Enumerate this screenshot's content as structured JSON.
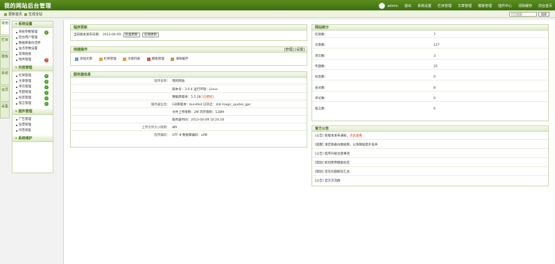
{
  "header": {
    "title": "我的网站后台管理",
    "user": "admin",
    "nav": [
      "退出",
      "系统设置",
      "栏目管理",
      "文章管理",
      "模板管理",
      "插件中心",
      "清除缓存",
      "前台首页"
    ]
  },
  "subbar": {
    "links": [
      "更新首页",
      "生成全站"
    ],
    "search_placeholder": "栏目搜索",
    "search_button": "搜索"
  },
  "vtabs": [
    "常用",
    "栏目",
    "模板",
    "系统",
    "会员",
    "采集"
  ],
  "sidebar": {
    "sections": [
      {
        "label": "系统设置",
        "items": [
          {
            "label": "系统参数管理",
            "status": "ok"
          },
          {
            "label": "后台用户管理",
            "status": ""
          },
          {
            "label": "数据库备份还原",
            "status": ""
          },
          {
            "label": "站点参数设置",
            "status": ""
          },
          {
            "label": "友情链接",
            "status": ""
          },
          {
            "label": "附件管理",
            "status": "bad"
          }
        ]
      },
      {
        "label": "内容管理",
        "items": [
          {
            "label": "栏目管理",
            "status": "ok"
          },
          {
            "label": "文章管理",
            "status": "ok"
          },
          {
            "label": "单页管理",
            "status": "ok"
          },
          {
            "label": "专题管理",
            "status": "ok"
          },
          {
            "label": "标签管理",
            "status": "ok"
          },
          {
            "label": "留言管理",
            "status": "ok"
          }
        ]
      },
      {
        "label": "插件管理",
        "items": [
          {
            "label": "广告管理",
            "status": ""
          },
          {
            "label": "投票管理",
            "status": ""
          },
          {
            "label": "问卷调查",
            "status": ""
          }
        ]
      },
      {
        "label": "系统维护",
        "items": []
      }
    ]
  },
  "panels": {
    "update": {
      "title": "程序更新",
      "text": "当前版本发布日期：",
      "date": "2013-04-09",
      "btn_check": "检查更新",
      "btn_update": "在线更新"
    },
    "quick": {
      "title": "快捷操作",
      "links": [
        "[管理]",
        "[设置]"
      ],
      "items": [
        "添加文章",
        "栏目管理",
        "文章列表",
        "模板管理",
        "清除缓存"
      ]
    },
    "sysinfo": {
      "title": "服务器信息",
      "rows": [
        {
          "label": "程序名称：",
          "value": "我的网站"
        },
        {
          "label": "",
          "value": "版本号：3.0.4  运行环境：Linux"
        },
        {
          "label": "",
          "value": "数据库版本：5.5.28 ",
          "red": "[已授权]"
        },
        {
          "label": "服务器信息：",
          "value": "GD库版本：bundled  已开启：zlib magic_quotes_gpc"
        },
        {
          "label": "",
          "value": "文件上传限制：2M  内存限制：128M"
        },
        {
          "label": "",
          "value": "服务器时间：2013-04-09 10:24:18"
        },
        {
          "label": "上传文件大小限制：",
          "value": "8M"
        },
        {
          "label": "程序编码：",
          "value": "UTF-8  数据库编码：utf8"
        }
      ]
    },
    "stats": {
      "title": "网站统计",
      "rows": [
        {
          "k": "栏目数：",
          "v": "7"
        },
        {
          "k": "文章数：",
          "v": "127"
        },
        {
          "k": "单页数：",
          "v": "3"
        },
        {
          "k": "专题数：",
          "v": "25"
        },
        {
          "k": "标签数：",
          "v": "0"
        },
        {
          "k": "会员数：",
          "v": "8"
        },
        {
          "k": "评论数：",
          "v": "0"
        },
        {
          "k": "留言数：",
          "v": "6"
        }
      ]
    },
    "news": {
      "title": "官方公告",
      "items": [
        {
          "text": "[公告] 新版本发布通知，",
          "red": "点此查看"
        },
        {
          "text": "[提醒] 请定期备份数据库，以免数据意外丢失"
        },
        {
          "text": "[公告] 程序升级注意事项"
        },
        {
          "text": "[帮助] 如何使用模板标签"
        },
        {
          "text": "[帮助] 常见问题解答汇总"
        },
        {
          "text": "[公告] 官方交流群"
        }
      ]
    }
  }
}
